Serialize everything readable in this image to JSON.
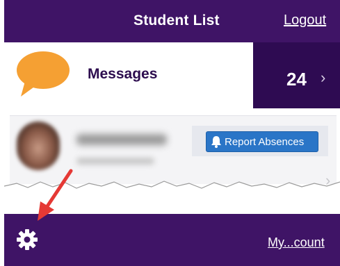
{
  "header": {
    "title": "Student List",
    "logout_label": "Logout"
  },
  "messages": {
    "label": "Messages",
    "count": "24",
    "chevron": "›",
    "icon": "speech-bubble-icon"
  },
  "student": {
    "report_button_label": "Report Absences",
    "report_icon": "bell-icon",
    "chevron": "›"
  },
  "footer": {
    "settings_icon": "gear-icon",
    "account_label": "My...count"
  },
  "colors": {
    "brand_purple": "#3f1466",
    "dark_purple": "#2e0b52",
    "bubble_orange": "#f5a033",
    "button_blue": "#2a75c7",
    "annotation_red": "#e53935"
  }
}
